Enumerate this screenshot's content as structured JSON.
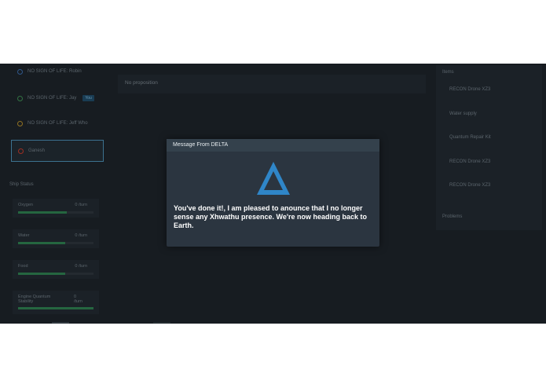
{
  "crew": [
    {
      "label": "NO SIGN OF LIFE: Robin",
      "icon_color": "#3a6aa8"
    },
    {
      "label": "NO SIGN OF LIFE: Jay",
      "icon_color": "#3e8a52",
      "badge": "You"
    },
    {
      "label": "NO SIGN OF LIFE: Jeff Who",
      "icon_color": "#b08a2a"
    },
    {
      "label": "Ganesh",
      "icon_color": "#c0392b"
    }
  ],
  "ship_status": {
    "title": "Ship Status",
    "stats": [
      {
        "name": "Oxygen",
        "value": "0 /turn",
        "level": 0.65
      },
      {
        "name": "Water",
        "value": "0 /turn",
        "level": 0.62
      },
      {
        "name": "Food",
        "value": "0 /turn",
        "level": 0.62
      },
      {
        "name": "Engine Quantum\nStability",
        "value": "0\n/turn",
        "level": 1.0
      }
    ]
  },
  "proposition": "No proposition",
  "items": {
    "title": "Items",
    "list": [
      "RECON Drone XZ3",
      "Water supply",
      "Quantum Repair Kit",
      "RECON Drone XZ3",
      "RECON Drone XZ3"
    ]
  },
  "problems_title": "Problems",
  "modal": {
    "title": "Message From DELTA",
    "message": "You've done it!, I am pleased to anounce that I no longer sense any Xhwathu presence. We're now heading back to Earth.",
    "icon_color": "#2f86c8"
  }
}
